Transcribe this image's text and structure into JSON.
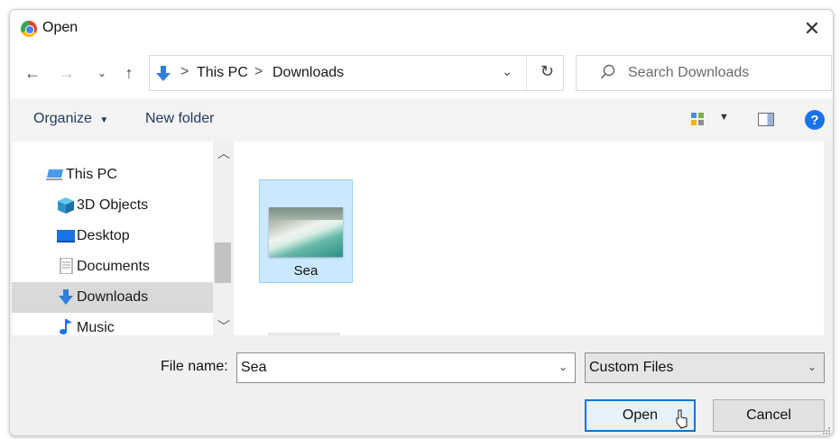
{
  "window": {
    "title": "Open"
  },
  "navigation": {
    "back_icon": "arrow-left-icon",
    "forward_icon": "arrow-right-icon",
    "recent_icon": "chevron-down-icon",
    "up_icon": "arrow-up-icon",
    "breadcrumbs": [
      "This PC",
      "Downloads"
    ],
    "separator": ">",
    "refresh_icon": "refresh-icon"
  },
  "search": {
    "placeholder": "Search Downloads"
  },
  "toolbar": {
    "organize_label": "Organize",
    "new_folder_label": "New folder",
    "help_label": "?"
  },
  "sidebar": {
    "items": [
      {
        "label": "This PC",
        "icon": "computer-icon",
        "selected": false
      },
      {
        "label": "3D Objects",
        "icon": "cube-icon",
        "selected": false
      },
      {
        "label": "Desktop",
        "icon": "desktop-icon",
        "selected": false
      },
      {
        "label": "Documents",
        "icon": "document-icon",
        "selected": false
      },
      {
        "label": "Downloads",
        "icon": "download-arrow-icon",
        "selected": true
      },
      {
        "label": "Music",
        "icon": "music-note-icon",
        "selected": false
      }
    ]
  },
  "files": [
    {
      "name": "Sea",
      "selected": true,
      "icon": "image-thumbnail"
    }
  ],
  "footer": {
    "file_name_label": "File name:",
    "file_name_value": "Sea",
    "file_type_value": "Custom Files",
    "open_label": "Open",
    "cancel_label": "Cancel"
  },
  "colors": {
    "accent": "#0078d7",
    "selection": "#cce8ff",
    "folder_blue": "#1a73e8"
  }
}
